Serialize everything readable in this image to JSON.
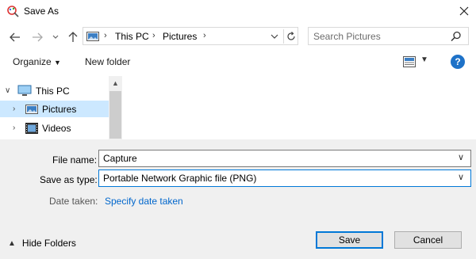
{
  "window": {
    "title": "Save As"
  },
  "nav": {
    "crumbs": [
      "This PC",
      "Pictures"
    ],
    "search_placeholder": "Search Pictures"
  },
  "toolbar": {
    "organize_label": "Organize",
    "new_folder_label": "New folder",
    "help_label": "?"
  },
  "tree": {
    "items": [
      {
        "label": "This PC",
        "icon": "computer-icon",
        "expanded": true
      },
      {
        "label": "Pictures",
        "icon": "pictures-folder-icon",
        "selected": true
      },
      {
        "label": "Videos",
        "icon": "videos-folder-icon"
      }
    ]
  },
  "form": {
    "file_name_label": "File name:",
    "file_name_value": "Capture",
    "save_type_label": "Save as type:",
    "save_type_value": "Portable Network Graphic file (PNG)",
    "date_taken_label": "Date taken:",
    "date_taken_link": "Specify date taken"
  },
  "footer": {
    "hide_folders_label": "Hide Folders",
    "save_label": "Save",
    "cancel_label": "Cancel"
  },
  "colors": {
    "accent": "#0078d7",
    "selection": "#cce8ff",
    "link": "#0066cc",
    "help": "#1e72c8"
  }
}
